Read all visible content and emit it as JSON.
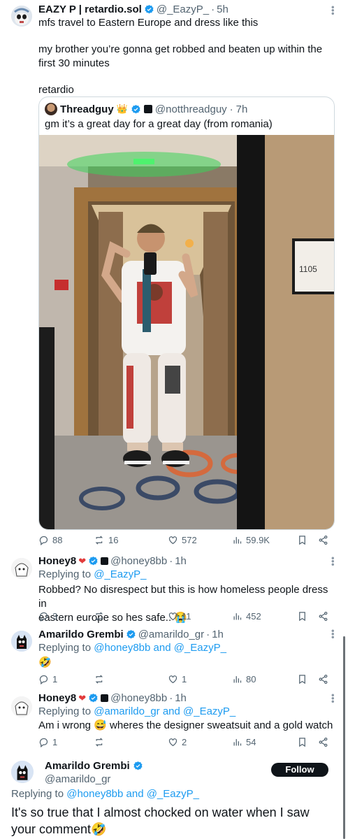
{
  "main_tweet": {
    "name": "EAZY P | retardio.sol",
    "handle": "@_EazyP_",
    "time": "5h",
    "line1": "mfs travel to Eastern Europe and dress like this",
    "line2": "my brother you’re gonna get robbed and beaten up within the",
    "line3": "first 30 minutes",
    "line4": "retardio",
    "quote": {
      "name": "Threadguy",
      "badge": "👑",
      "handle": "@notthreadguy",
      "time": "7h",
      "text": "gm it’s a great day for a great day (from romania)",
      "room_number": "1105"
    },
    "stats": {
      "replies": "88",
      "reposts": "16",
      "likes": "572",
      "views": "59.9K"
    }
  },
  "replies": [
    {
      "name": "Honey8",
      "handle": "@honey8bb",
      "time": "1h",
      "replying_prefix": "Replying to ",
      "replying_to": "@_EazyP_",
      "line1": "Robbed? No disrespect but this is how homeless people dress in",
      "line2": "eastern europe so hes safe.. 😭",
      "stats": {
        "replies": "3",
        "reposts": "",
        "likes": "11",
        "views": "452"
      }
    },
    {
      "name": "Amarildo Grembi",
      "handle": "@amarildo_gr",
      "time": "1h",
      "replying_prefix": "Replying to ",
      "replying_to": "@honey8bb and @_EazyP_",
      "line1": "🤣",
      "stats": {
        "replies": "1",
        "reposts": "",
        "likes": "1",
        "views": "80"
      }
    },
    {
      "name": "Honey8",
      "handle": "@honey8bb",
      "time": "1h",
      "replying_prefix": "Replying to ",
      "replying_to": "@amarildo_gr and @_EazyP_",
      "line1": "Am i wrong 😅 wheres the designer sweatsuit and a gold watch",
      "stats": {
        "replies": "1",
        "reposts": "",
        "likes": "2",
        "views": "54"
      }
    }
  ],
  "focused_reply": {
    "name": "Amarildo Grembi",
    "handle": "@amarildo_gr",
    "follow_label": "Follow",
    "replying_prefix": "Replying to ",
    "replying_to": "@honey8bb and @_EazyP_",
    "line1": "It's so true that I almost chocked on water when I saw",
    "line2": "your comment🤣"
  },
  "colors": {
    "accent": "#1d9bf0",
    "muted": "#536471",
    "text": "#0f1419",
    "border": "#cfd9de"
  }
}
